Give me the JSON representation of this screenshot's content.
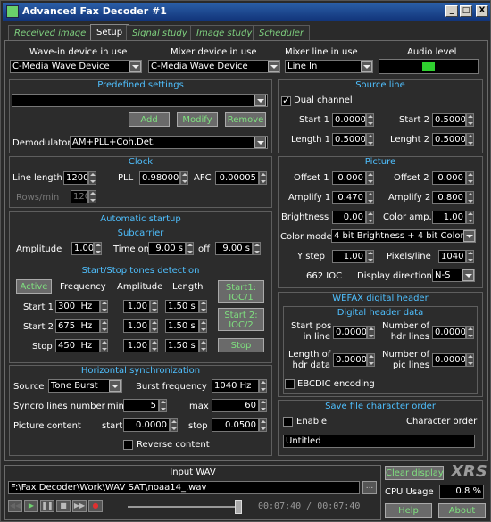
{
  "window": {
    "title": "Advanced Fax Decoder #1",
    "min": "_",
    "max": "□",
    "close": "X"
  },
  "tabs": [
    "Received image",
    "Setup",
    "Signal study",
    "Image study",
    "Scheduler"
  ],
  "devices": {
    "wavein_label": "Wave-in device in use",
    "wavein_value": "C-Media Wave Device",
    "mixer_label": "Mixer device in use",
    "mixer_value": "C-Media Wave Device",
    "mixerline_label": "Mixer line in use",
    "mixerline_value": "Line In",
    "audio_label": "Audio level"
  },
  "predef": {
    "title": "Predefined settings",
    "value": "",
    "add": "Add",
    "modify": "Modify",
    "remove": "Remove",
    "demod_label": "Demodulator",
    "demod_value": "AM+PLL+Coh.Det."
  },
  "source": {
    "title": "Source line",
    "dual": "Dual channel",
    "start1_label": "Start 1",
    "start1": "0.0000",
    "start2_label": "Start 2",
    "start2": "0.5000",
    "len1_label": "Length 1",
    "len1": "0.5000",
    "len2_label": "Lenght 2",
    "len2": "0.5000"
  },
  "clock": {
    "title": "Clock",
    "linelen_label": "Line length",
    "linelen": "1200",
    "pll_label": "PLL",
    "pll": "0.98000",
    "afc_label": "AFC",
    "afc": "0.00005",
    "rows_label": "Rows/min",
    "rows": "120"
  },
  "picture": {
    "title": "Picture",
    "off1_label": "Offset 1",
    "off1": "0.000",
    "off2_label": "Offset 2",
    "off2": "0.000",
    "amp1_label": "Amplify 1",
    "amp1": "0.470",
    "amp2_label": "Amplify 2",
    "amp2": "0.800",
    "bright_label": "Brightness",
    "bright": "0.00",
    "colamp_label": "Color amp.",
    "colamp": "1.00",
    "colmode_label": "Color mode",
    "colmode": "4 bit Brightness + 4 bit Color",
    "ystep_label": "Y step",
    "ystep": "1.00",
    "pxline_label": "Pixels/line",
    "pxline": "1040",
    "ioc": "662 IOC",
    "dispdir_label": "Display direction",
    "dispdir": "N-S"
  },
  "autostart": {
    "title": "Automatic startup",
    "sub_title": "Subcarrier",
    "ampl_label": "Amplitude",
    "ampl": "1.00",
    "timeon_label": "Time on",
    "timeon": "9.00 s",
    "off_label": "off",
    "off": "9.00 s"
  },
  "tones": {
    "title": "Start/Stop tones detection",
    "active": "Active",
    "h_freq": "Frequency",
    "h_amp": "Amplitude",
    "h_len": "Length",
    "rows": [
      {
        "label": "Start 1",
        "freq": "300",
        "unit": "Hz",
        "amp": "1.00",
        "len": "1.50 s"
      },
      {
        "label": "Start 2",
        "freq": "675",
        "unit": "Hz",
        "amp": "1.00",
        "len": "1.50 s"
      },
      {
        "label": "Stop",
        "freq": "450",
        "unit": "Hz",
        "amp": "1.00",
        "len": "1.50 s"
      }
    ],
    "b1a": "Start1:",
    "b1b": "IOC/1",
    "b2a": "Start 2:",
    "b2b": "IOC/2",
    "b3": "Stop"
  },
  "hsync": {
    "title": "Horizontal synchronization",
    "source_label": "Source",
    "source": "Tone Burst",
    "burst_label": "Burst frequency",
    "burst": "1040 Hz",
    "sync_label": "Syncro lines number",
    "min_label": "min",
    "min": "5",
    "max_label": "max",
    "max": "60",
    "pic_label": "Picture content",
    "start_label": "start",
    "start": "0.0000",
    "stop_label": "stop",
    "stop": "0.0500",
    "reverse": "Reverse content"
  },
  "wefax": {
    "title": "WEFAX digital header",
    "sub": "Digital header data",
    "startpos_a": "Start pos",
    "startpos_b": "in line",
    "startpos": "0.0000",
    "nhdr_a": "Number of",
    "nhdr_b": "hdr lines",
    "nhdr": "0.0000",
    "lenhdr_a": "Length of",
    "lenhdr_b": "hdr data",
    "lenhdr": "0.0000",
    "npic_a": "Number of",
    "npic_b": "pic lines",
    "npic": "0.0000",
    "ebcdic": "EBCDIC encoding"
  },
  "savefile": {
    "title": "Save file character order",
    "enable": "Enable",
    "charorder": "Character order",
    "value": "Untitled"
  },
  "inputwav": {
    "title": "Input WAV",
    "path": "F:\\Fax Decoder\\Work\\WAV SAT\\noaa14_.wav",
    "browse": "...",
    "time": "00:07:40 / 00:07:40"
  },
  "right": {
    "clear": "Clear display",
    "logo": "XRS",
    "cpu_label": "CPU Usage",
    "cpu": "0.8 %",
    "help": "Help",
    "about": "About"
  }
}
